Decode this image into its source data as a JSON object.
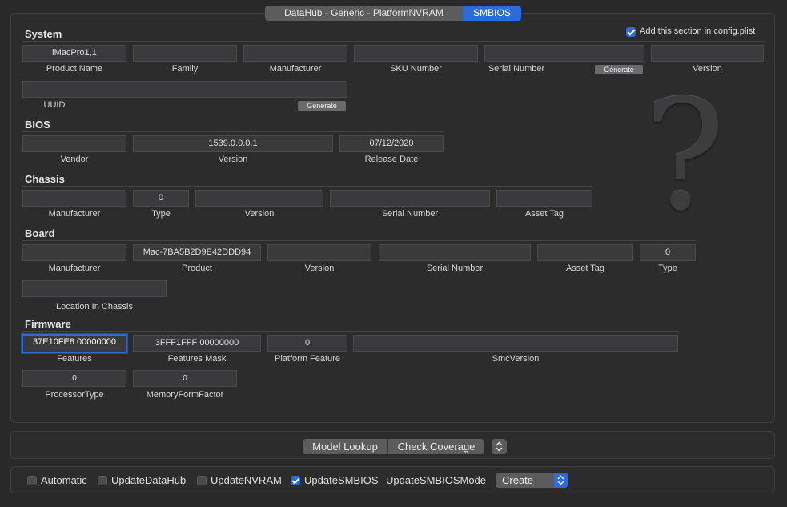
{
  "tabs": [
    {
      "label": "DataHub - Generic - PlatformNVRAM",
      "active": false
    },
    {
      "label": "SMBIOS",
      "active": true
    }
  ],
  "add_section": {
    "label": "Add this section in config.plist",
    "checked": true
  },
  "system": {
    "title": "System",
    "product_name": {
      "label": "Product Name",
      "value": "iMacPro1,1"
    },
    "family": {
      "label": "Family",
      "value": ""
    },
    "manufacturer": {
      "label": "Manufacturer",
      "value": ""
    },
    "sku_number": {
      "label": "SKU Number",
      "value": ""
    },
    "serial_number": {
      "label": "Serial Number",
      "value": "",
      "generate_label": "Generate"
    },
    "version": {
      "label": "Version",
      "value": ""
    },
    "uuid": {
      "label": "UUID",
      "value": "",
      "generate_label": "Generate"
    }
  },
  "bios": {
    "title": "BIOS",
    "vendor": {
      "label": "Vendor",
      "value": ""
    },
    "version": {
      "label": "Version",
      "value": "1539.0.0.0.1"
    },
    "release_date": {
      "label": "Release Date",
      "value": "07/12/2020"
    }
  },
  "chassis": {
    "title": "Chassis",
    "manufacturer": {
      "label": "Manufacturer",
      "value": ""
    },
    "type": {
      "label": "Type",
      "value": "0"
    },
    "version": {
      "label": "Version",
      "value": ""
    },
    "serial_number": {
      "label": "Serial Number",
      "value": ""
    },
    "asset_tag": {
      "label": "Asset Tag",
      "value": ""
    }
  },
  "board": {
    "title": "Board",
    "manufacturer": {
      "label": "Manufacturer",
      "value": ""
    },
    "product": {
      "label": "Product",
      "value": "Mac-7BA5B2D9E42DDD94"
    },
    "version": {
      "label": "Version",
      "value": ""
    },
    "serial_number": {
      "label": "Serial Number",
      "value": ""
    },
    "asset_tag": {
      "label": "Asset Tag",
      "value": ""
    },
    "type": {
      "label": "Type",
      "value": "0"
    },
    "location_in_chassis": {
      "label": "Location In Chassis",
      "value": ""
    }
  },
  "firmware": {
    "title": "Firmware",
    "features": {
      "label": "Features",
      "value": "37E10FE8 00000000"
    },
    "features_mask": {
      "label": "Features Mask",
      "value": "3FFF1FFF 00000000"
    },
    "platform_feature": {
      "label": "Platform Feature",
      "value": "0"
    },
    "smc_version": {
      "label": "SmcVersion",
      "value": ""
    },
    "processor_type": {
      "label": "ProcessorType",
      "value": "0"
    },
    "memory_form_factor": {
      "label": "MemoryFormFactor",
      "value": "0"
    }
  },
  "placeholder_glyph": "?",
  "lookup_bar": {
    "model_lookup": "Model Lookup",
    "check_coverage": "Check Coverage",
    "stepper_icon": "up-down-chevron-icon"
  },
  "options": {
    "automatic": {
      "label": "Automatic",
      "checked": false
    },
    "update_datahub": {
      "label": "UpdateDataHub",
      "checked": false
    },
    "update_nvram": {
      "label": "UpdateNVRAM",
      "checked": false
    },
    "update_smbios": {
      "label": "UpdateSMBIOS",
      "checked": true
    },
    "update_smbios_mode": {
      "label": "UpdateSMBIOSMode",
      "value": "Create"
    }
  },
  "colors": {
    "accent": "#2f6bd8",
    "background": "#29292a",
    "field": "#3a3a3c"
  }
}
